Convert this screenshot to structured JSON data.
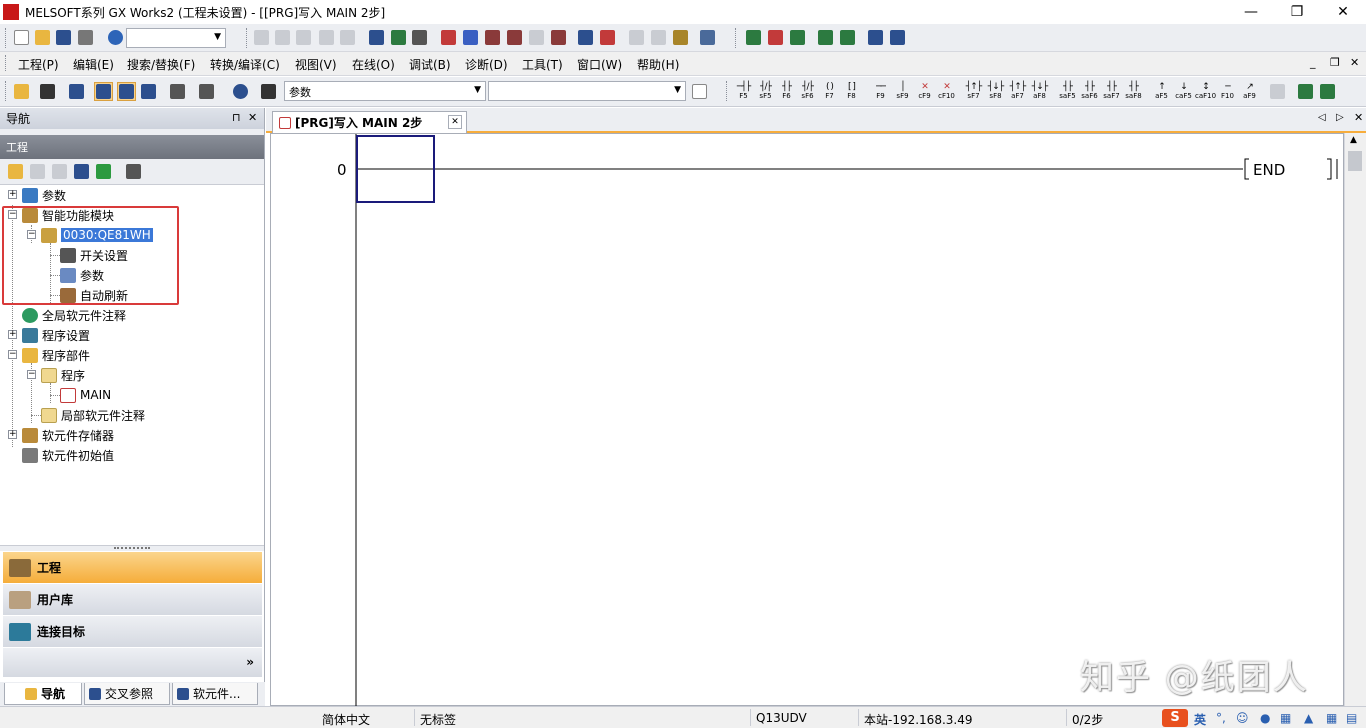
{
  "window": {
    "app_icon": "MELSOFT",
    "title": "MELSOFT系列 GX Works2 (工程未设置) - [[PRG]写入 MAIN 2步]",
    "minimize": "—",
    "restore": "❐",
    "close": "✕"
  },
  "menu": {
    "items": [
      "工程(P)",
      "编辑(E)",
      "搜索/替换(F)",
      "转换/编译(C)",
      "视图(V)",
      "在线(O)",
      "调试(B)",
      "诊断(D)",
      "工具(T)",
      "窗口(W)",
      "帮助(H)"
    ]
  },
  "toolbar2": {
    "combo_value": "参数",
    "fkeys": [
      {
        "sym": "─┤├",
        "label": "F5"
      },
      {
        "sym": "┤/├",
        "label": "sF5"
      },
      {
        "sym": "┤├",
        "label": "F6"
      },
      {
        "sym": "┤/├",
        "label": "sF6"
      },
      {
        "sym": "( )",
        "label": "F7"
      },
      {
        "sym": "[ ]",
        "label": "F8"
      },
      {
        "sym": "──",
        "label": "F9"
      },
      {
        "sym": "│",
        "label": "sF9"
      },
      {
        "sym": "✕",
        "label": "cF9"
      },
      {
        "sym": "✕",
        "label": "cF10"
      },
      {
        "sym": "┤↑├",
        "label": "sF7"
      },
      {
        "sym": "┤↓├",
        "label": "sF8"
      },
      {
        "sym": "┤↑├",
        "label": "aF7"
      },
      {
        "sym": "┤↓├",
        "label": "aF8"
      },
      {
        "sym": "┤├",
        "label": "saF5"
      },
      {
        "sym": "┤├",
        "label": "saF6"
      },
      {
        "sym": "┤├",
        "label": "saF7"
      },
      {
        "sym": "┤├",
        "label": "saF8"
      },
      {
        "sym": "↑",
        "label": "aF5"
      },
      {
        "sym": "↓",
        "label": "caF5"
      },
      {
        "sym": "↕",
        "label": "caF10"
      },
      {
        "sym": "─",
        "label": "F10"
      },
      {
        "sym": "↗",
        "label": "aF9"
      }
    ]
  },
  "nav": {
    "title": "导航",
    "pin": "⊓",
    "close": "✕",
    "project_header": "工程",
    "tree": {
      "parameters": "参数",
      "intelligent_modules": "智能功能模块",
      "module": "0030:QE81WH",
      "switch_settings": "开关设置",
      "module_parameters": "参数",
      "auto_refresh": "自动刷新",
      "global_comments": "全局软元件注释",
      "program_settings": "程序设置",
      "program_parts": "程序部件",
      "program": "程序",
      "main": "MAIN",
      "local_comments": "局部软元件注释",
      "device_memory": "软元件存储器",
      "device_initial": "软元件初始值"
    },
    "buttons": {
      "project": "工程",
      "user_library": "用户库",
      "connection_target": "连接目标",
      "more": "»"
    },
    "tabs": [
      "导航",
      "交叉参照",
      "软元件..."
    ]
  },
  "editor": {
    "tab_title": "[PRG]写入 MAIN 2步",
    "tab_close": "✕",
    "step_number": "0",
    "end_instruction": "END"
  },
  "status": {
    "language": "简体中文",
    "label": "无标签",
    "cpu": "Q13UDV",
    "station": "本站-192.168.3.49",
    "steps": "0/2步",
    "ime_language": "英"
  },
  "watermark": "知乎 @纸团人",
  "colors": {
    "accent_orange": "#f7ad3c",
    "selection_blue": "#3b78d8",
    "highlight_red": "#d93a3a",
    "cursor_navy": "#1a1a7a"
  }
}
